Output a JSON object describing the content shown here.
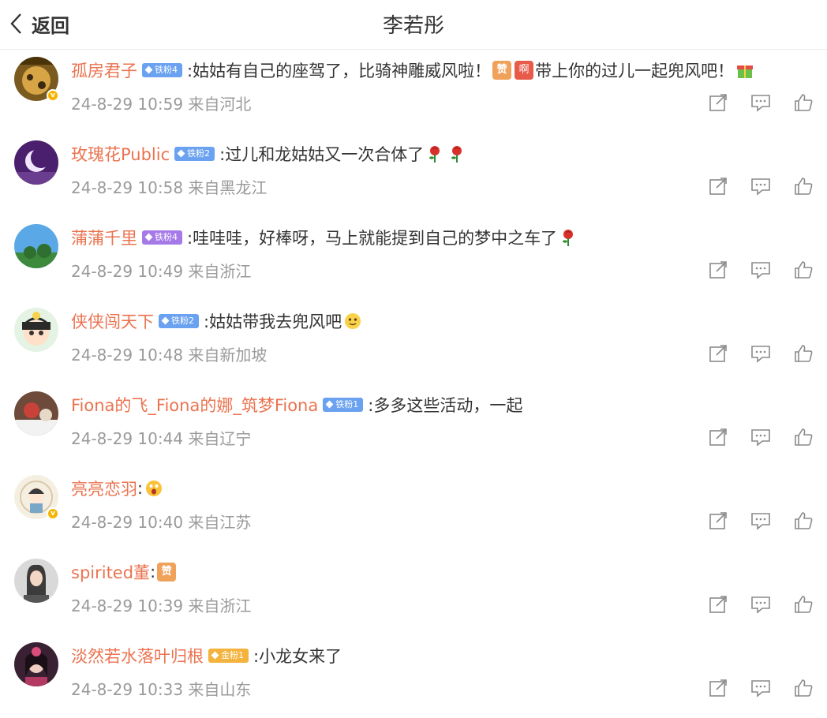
{
  "header": {
    "back_label": "返回",
    "title": "李若彤"
  },
  "comments": [
    {
      "user": "孤房君子",
      "badge": "铁粉4",
      "badge_color": "#6aa1f0",
      "verified": true,
      "text_a": ":姑姑有自己的座驾了，比骑神雕威风啦！",
      "text_b": "带上你的过儿一起兜风吧！",
      "emoji_a": [
        "赞",
        "啊"
      ],
      "emoji_b": [
        "gift"
      ],
      "meta": "24-8-29 10:59 来自河北"
    },
    {
      "user": "玫瑰花Public",
      "badge": "铁粉2",
      "badge_color": "#6aa1f0",
      "verified": false,
      "text_a": ":过儿和龙姑姑又一次合体了",
      "emoji_a": [
        "rose",
        "rose"
      ],
      "meta": "24-8-29 10:58 来自黑龙江"
    },
    {
      "user": "蒲蒲千里",
      "badge": "铁粉4",
      "badge_color": "#a57ae8",
      "verified": false,
      "text_a": ":哇哇哇，好棒呀，马上就能提到自己的梦中之车了",
      "emoji_a": [
        "rose"
      ],
      "meta": "24-8-29 10:49 来自浙江"
    },
    {
      "user": "侠侠闯天下",
      "badge": "铁粉2",
      "badge_color": "#6aa1f0",
      "verified": false,
      "text_a": ":姑姑带我去兜风吧",
      "emoji_a": [
        "smile"
      ],
      "meta": "24-8-29 10:48 来自新加坡"
    },
    {
      "user": "Fiona的飞_Fiona的娜_筑梦Fiona",
      "badge": "铁粉1",
      "badge_color": "#6aa1f0",
      "verified": false,
      "text_a": ":多多这些活动，一起",
      "emoji_a": [],
      "meta": "24-8-29 10:44 来自辽宁"
    },
    {
      "user": "亮亮恋羽",
      "badge": "",
      "badge_color": "",
      "verified": true,
      "text_a": ":",
      "emoji_a": [
        "wow"
      ],
      "meta": "24-8-29 10:40 来自江苏"
    },
    {
      "user": "spirited董",
      "badge": "",
      "badge_color": "",
      "verified": false,
      "text_a": ":",
      "emoji_a": [
        "赞"
      ],
      "meta": "24-8-29 10:39 来自浙江"
    },
    {
      "user": "淡然若水落叶归根",
      "badge": "金粉1",
      "badge_color": "#f3b33d",
      "verified": false,
      "text_a": ":小龙女来了",
      "emoji_a": [],
      "meta": "24-8-29 10:33 来自山东"
    }
  ],
  "colors": {
    "username": "#eb7350",
    "meta": "#9a9a9a",
    "icon": "#8a8a8a"
  }
}
